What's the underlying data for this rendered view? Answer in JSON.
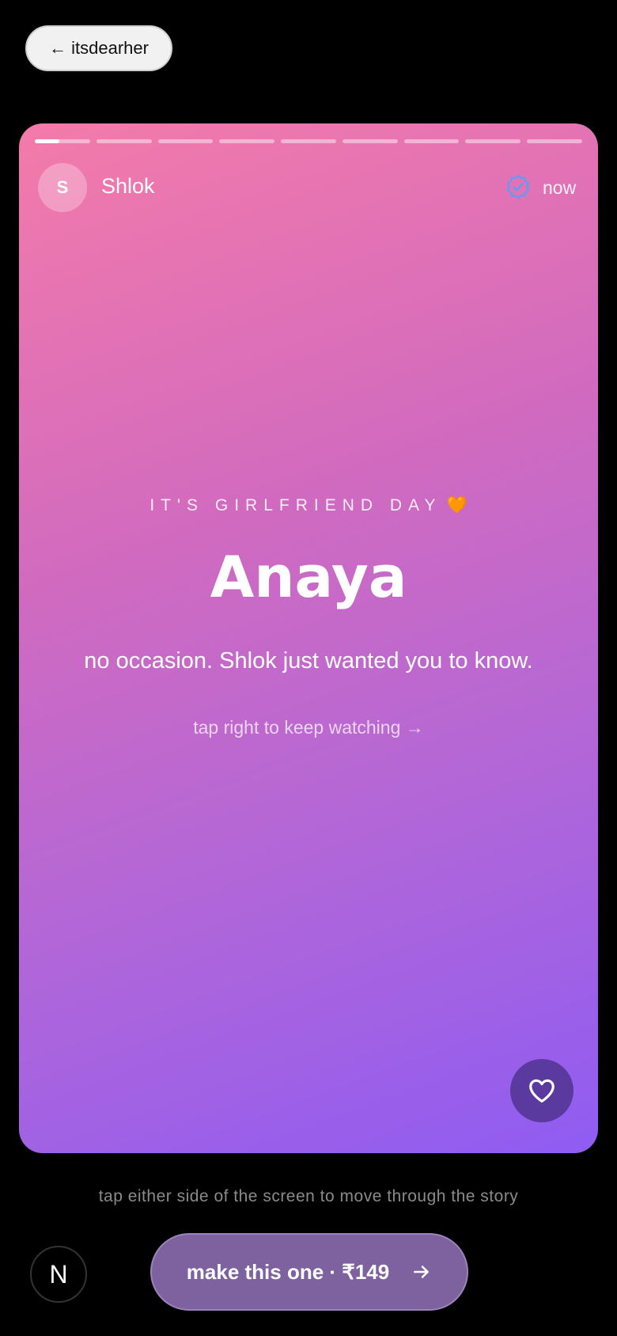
{
  "back_button": {
    "label": "← itsdearher"
  },
  "story": {
    "progress": {
      "segment_count": 9,
      "active_index": 0,
      "active_fraction": 0.45
    },
    "header": {
      "avatar_initial": "S",
      "sender_name": "Shlok",
      "verified_icon": "verified-badge-icon",
      "time": "now"
    },
    "eyebrow": "IT'S GIRLFRIEND DAY",
    "eyebrow_emoji": "🧡",
    "name": "Anaya",
    "message": "no occasion. Shlok just wanted you to know.",
    "hint": "tap right to keep watching →",
    "like_icon": "heart-icon"
  },
  "footer": {
    "hint": "tap either side of the screen to move through the story",
    "logo_letter": "N",
    "cta_label": "make this one · ₹149",
    "cta_icon": "arrow-right-icon"
  },
  "colors": {
    "gradient_start": "#f47baa",
    "gradient_end": "#8f5cf2",
    "like_button": "#5b3aa0",
    "cta": "#7e62a0",
    "verified": "#4aa3ff"
  }
}
